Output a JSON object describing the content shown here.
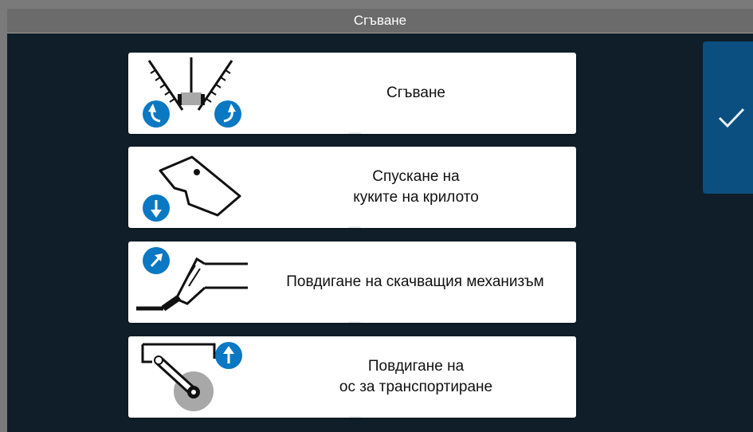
{
  "window": {
    "title": "Сгъване"
  },
  "actions": [
    {
      "label": "Сгъване",
      "illustration": "folding-wings-icon"
    },
    {
      "label": "Спускане на\nкуките на крилото",
      "illustration": "wing-hook-lower-icon"
    },
    {
      "label": "Повдигане на скачващия механизъм",
      "illustration": "coupling-lift-icon"
    },
    {
      "label": "Повдигане на\nос за транспортиране",
      "illustration": "transport-axle-lift-icon"
    }
  ],
  "confirm": {
    "icon": "checkmark-icon"
  },
  "colors": {
    "background": "#0f1e28",
    "titlebar": "#6b6b6b",
    "accent": "#0a78c2",
    "confirm_button": "#0a4f80"
  }
}
